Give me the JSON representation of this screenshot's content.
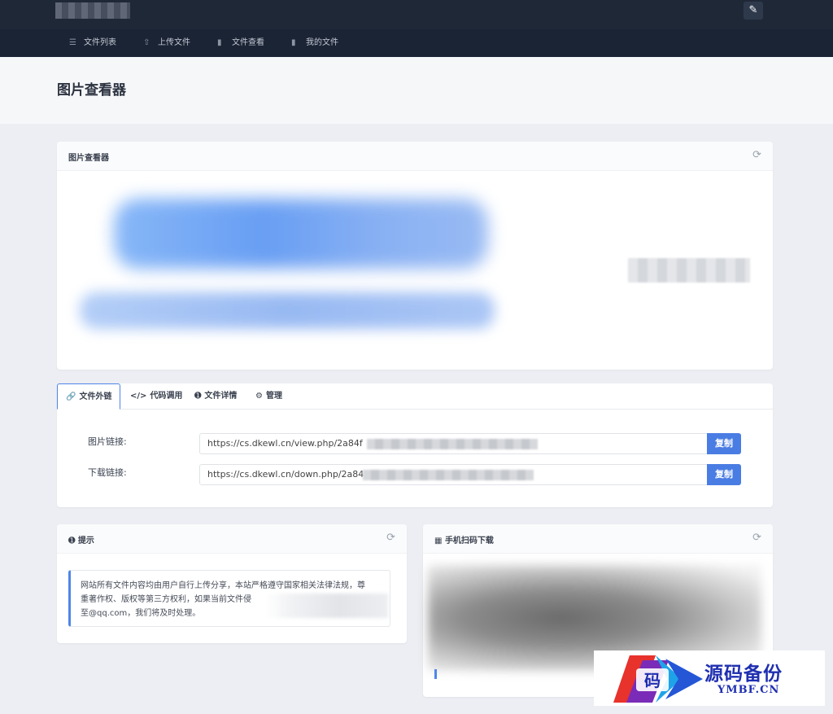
{
  "topbar": {
    "brush_icon": "paint-brush-icon"
  },
  "nav": {
    "items": [
      {
        "label": "文件列表",
        "icon": "list-icon"
      },
      {
        "label": "上传文件",
        "icon": "upload-icon"
      },
      {
        "label": "文件查看",
        "icon": "file-icon"
      },
      {
        "label": "我的文件",
        "icon": "file-icon"
      }
    ]
  },
  "page": {
    "title": "图片查看器"
  },
  "viewer": {
    "title": "图片查看器"
  },
  "tabs": [
    {
      "label": "文件外链",
      "icon": "link-icon"
    },
    {
      "label": "代码调用",
      "icon": "code-icon"
    },
    {
      "label": "文件详情",
      "icon": "info-icon"
    },
    {
      "label": "管理",
      "icon": "gear-icon"
    }
  ],
  "links": {
    "image_label": "图片链接:",
    "image_url": "https://cs.dkewl.cn/view.php/2a84f",
    "download_label": "下载链接:",
    "download_url": "https://cs.dkewl.cn/down.php/2a84",
    "copy_label": "复制"
  },
  "notice": {
    "title": "提示",
    "line1": "网站所有文件内容均由用户自行上传分享，本站严格遵守国家相关法律法规，尊",
    "line2": "重著作权、版权等第三方权利，如果当前文件侵",
    "line3": "至@qq.com，我们将及时处理。"
  },
  "qr": {
    "title": "手机扫码下载"
  },
  "watermark": {
    "text": "源码备份",
    "sub": "YMBF.CN",
    "logo_char": "码"
  },
  "colors": {
    "accent": "#4a7de3",
    "topbar": "#1e2837",
    "watermark": "#1f2fb0"
  }
}
